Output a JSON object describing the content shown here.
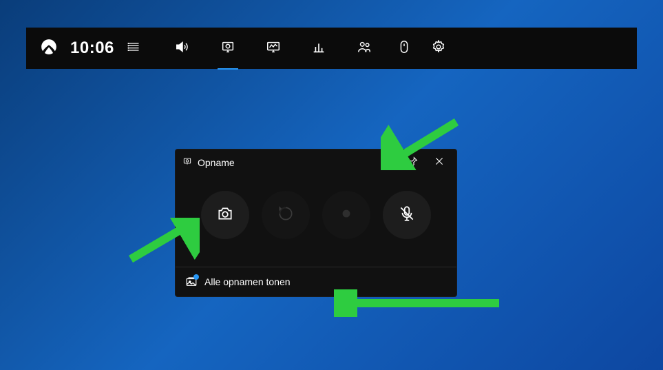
{
  "toolbar": {
    "time": "10:06"
  },
  "panel": {
    "title": "Opname",
    "footer_label": "Alle opnamen tonen"
  }
}
